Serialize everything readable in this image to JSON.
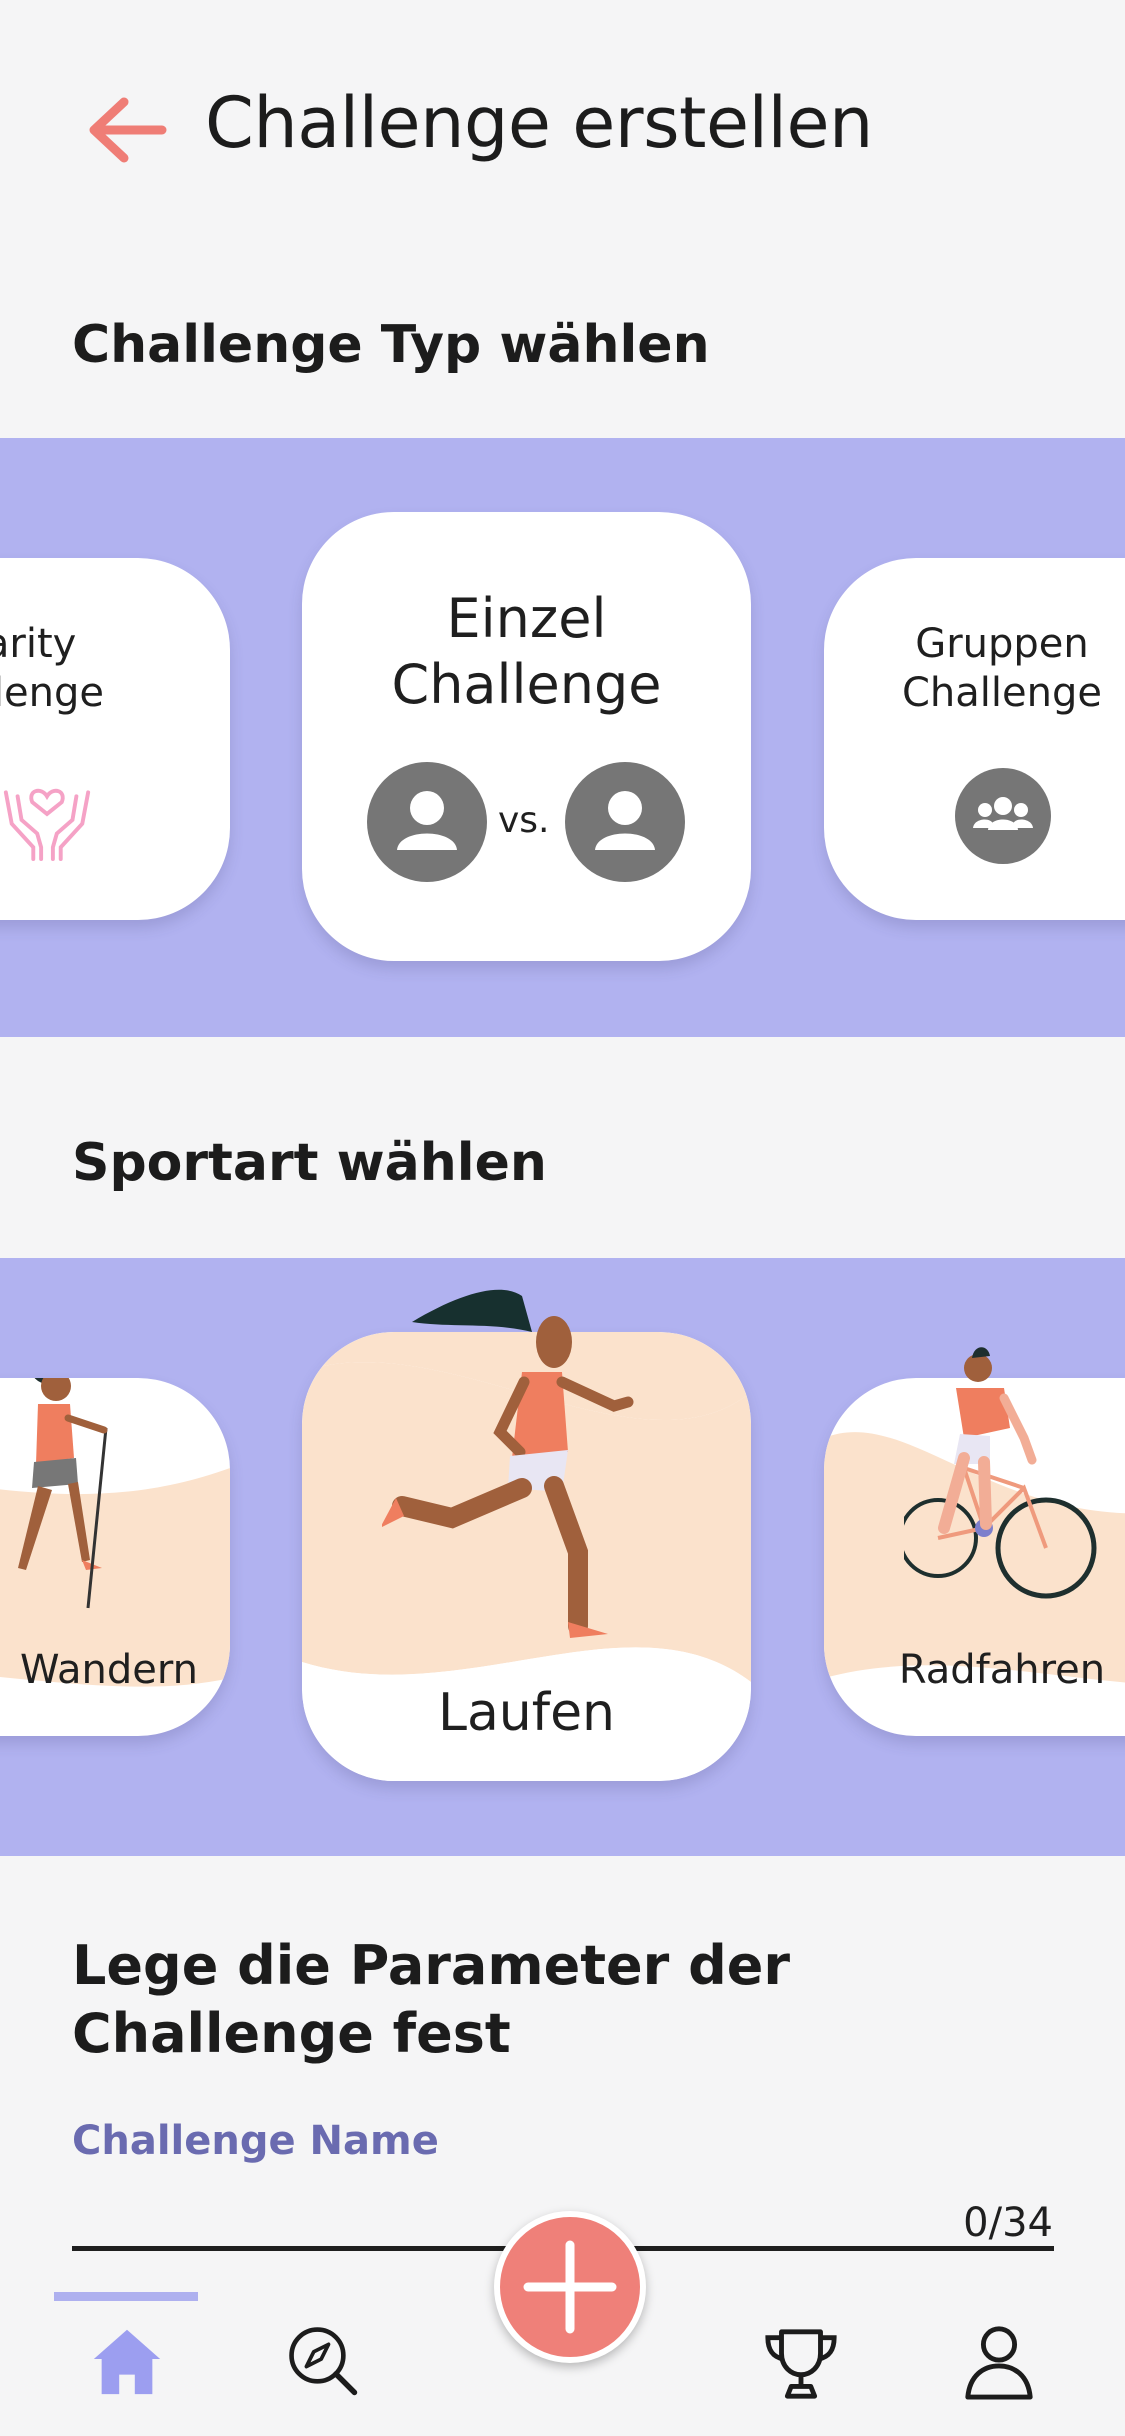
{
  "header": {
    "title": "Challenge erstellen",
    "back_icon": "arrow-left-icon",
    "accent": "#ef7d76"
  },
  "challenge_type": {
    "title": "Challenge Typ wählen",
    "cards": [
      {
        "label": "Charity\nChallenge",
        "icon": "heart-hands-icon"
      },
      {
        "label": "Einzel\nChallenge",
        "vs": "vs.",
        "icon": "person-vs-person-icon",
        "selected": true
      },
      {
        "label": "Gruppen\nChallenge",
        "icon": "group-icon"
      }
    ]
  },
  "sport": {
    "title": "Sportart wählen",
    "cards": [
      {
        "label": "Wandern",
        "icon": "hiking-woman-illustration"
      },
      {
        "label": "Laufen",
        "icon": "running-woman-illustration",
        "selected": true
      },
      {
        "label": "Radfahren",
        "icon": "cyclist-illustration"
      }
    ]
  },
  "parameters": {
    "title": "Lege die Parameter der\nChallenge fest",
    "name_field": {
      "label": "Challenge Name",
      "value": "",
      "counter": "0/34"
    }
  },
  "bottom_nav": {
    "items": [
      {
        "icon": "home-icon",
        "active": true
      },
      {
        "icon": "explore-icon"
      },
      {
        "icon": "add-icon"
      },
      {
        "icon": "trophy-icon"
      },
      {
        "icon": "profile-icon"
      }
    ]
  },
  "colors": {
    "band": "#b1b2f0",
    "active": "#9c9ef0",
    "label": "#6a6bb0",
    "fab": "#ef8079"
  }
}
